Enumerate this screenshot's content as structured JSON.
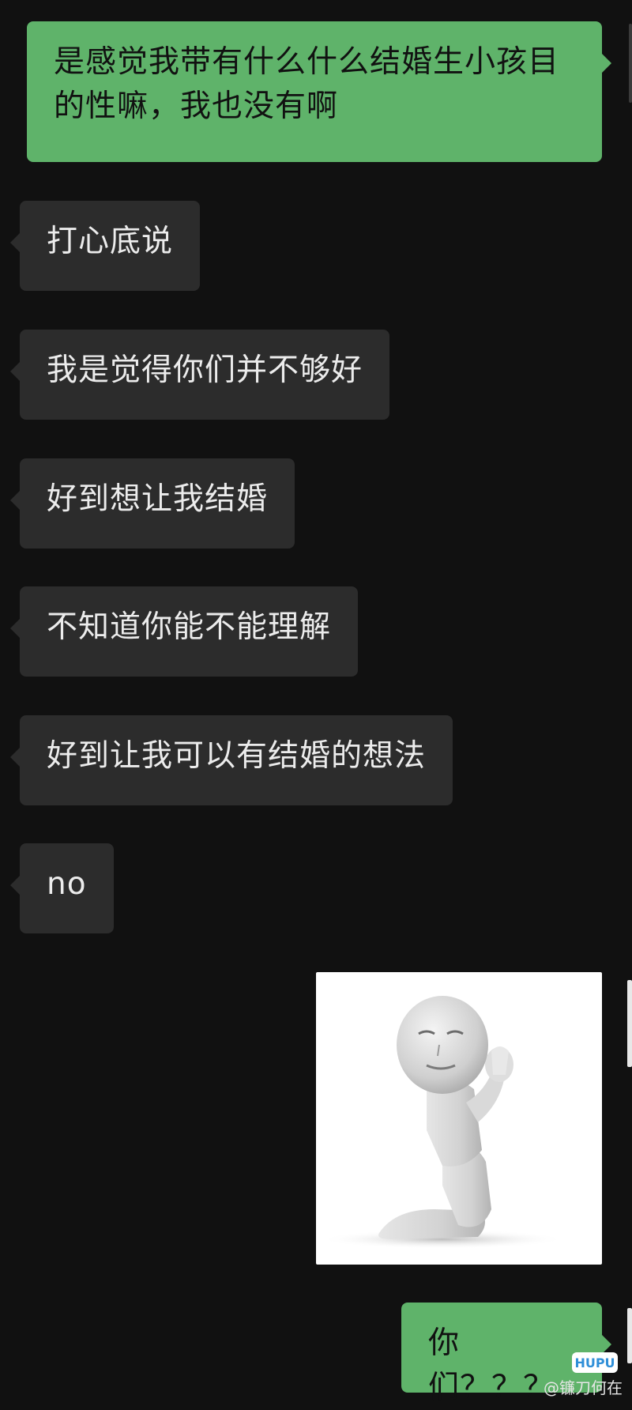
{
  "messages": [
    {
      "side": "sent",
      "text": "是感觉我带有什么什么结婚生小孩目的性嘛，我也没有啊"
    },
    {
      "side": "received",
      "text": "打心底说"
    },
    {
      "side": "received",
      "text": "我是觉得你们并不够好"
    },
    {
      "side": "received",
      "text": "好到想让我结婚"
    },
    {
      "side": "received",
      "text": "不知道你能不能理解"
    },
    {
      "side": "received",
      "text": "好到让我可以有结婚的想法"
    },
    {
      "side": "received",
      "text": "no"
    },
    {
      "side": "sent",
      "type": "sticker",
      "text": ""
    },
    {
      "side": "sent",
      "text": "你们？？？"
    }
  ],
  "watermark": {
    "logo_text": "HUPU",
    "caption": "@镰刀何在"
  },
  "colors": {
    "background": "#111111",
    "sent_bubble": "#5fb36a",
    "received_bubble": "#2c2c2c",
    "received_text": "#ececec"
  }
}
